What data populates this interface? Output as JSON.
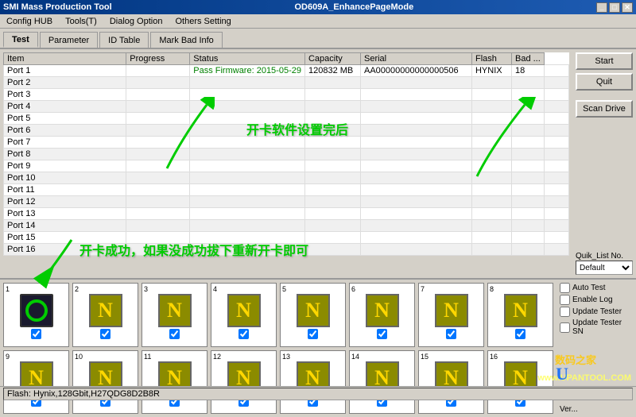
{
  "titleBar": {
    "left": "SMI Mass Production Tool",
    "right": "OD609A_EnhancePageMode",
    "minBtn": "_",
    "maxBtn": "□",
    "closeBtn": "✕"
  },
  "menuBar": {
    "items": [
      "Config HUB",
      "Tools(T)",
      "Dialog Option",
      "Others Setting"
    ]
  },
  "tabs": {
    "items": [
      "Test",
      "Parameter",
      "ID Table",
      "Mark Bad Info"
    ],
    "active": 0
  },
  "table": {
    "headers": [
      "Item",
      "Progress",
      "Status",
      "Capacity",
      "Serial",
      "Flash",
      "Bad ..."
    ],
    "rows": [
      [
        "Port 1",
        "",
        "Pass  Firmware: 2015-05-29",
        "120832 MB",
        "AA00000000000000506",
        "HYNIX",
        "18",
        ""
      ],
      [
        "Port 2",
        "",
        "",
        "",
        "",
        "",
        "",
        ""
      ],
      [
        "Port 3",
        "",
        "",
        "",
        "",
        "",
        "",
        ""
      ],
      [
        "Port 4",
        "",
        "",
        "",
        "",
        "",
        "",
        ""
      ],
      [
        "Port 5",
        "",
        "",
        "",
        "",
        "",
        "",
        ""
      ],
      [
        "Port 6",
        "",
        "",
        "",
        "",
        "",
        "",
        ""
      ],
      [
        "Port 7",
        "",
        "",
        "",
        "",
        "",
        "",
        ""
      ],
      [
        "Port 8",
        "",
        "",
        "",
        "",
        "",
        "",
        ""
      ],
      [
        "Port 9",
        "",
        "",
        "",
        "",
        "",
        "",
        ""
      ],
      [
        "Port 10",
        "",
        "",
        "",
        "",
        "",
        "",
        ""
      ],
      [
        "Port 11",
        "",
        "",
        "",
        "",
        "",
        "",
        ""
      ],
      [
        "Port 12",
        "",
        "",
        "",
        "",
        "",
        "",
        ""
      ],
      [
        "Port 13",
        "",
        "",
        "",
        "",
        "",
        "",
        ""
      ],
      [
        "Port 14",
        "",
        "",
        "",
        "",
        "",
        "",
        ""
      ],
      [
        "Port 15",
        "",
        "",
        "",
        "",
        "",
        "",
        ""
      ],
      [
        "Port 16",
        "",
        "",
        "",
        "",
        "",
        "",
        ""
      ]
    ]
  },
  "sidebar": {
    "startBtn": "Start",
    "quitBtn": "Quit",
    "scanBtn": "Scan Drive",
    "quikLabel": "Quik_List No.",
    "quikDefault": "Default"
  },
  "annotations": {
    "text1": "开卡软件设置完后",
    "text2": "开卡成功，如果没成功拔下重新开卡即可"
  },
  "ports": {
    "items": [
      {
        "num": "1",
        "type": "active",
        "checked": true
      },
      {
        "num": "2",
        "type": "n",
        "checked": true
      },
      {
        "num": "3",
        "type": "n",
        "checked": true
      },
      {
        "num": "4",
        "type": "n",
        "checked": true
      },
      {
        "num": "5",
        "type": "n",
        "checked": true
      },
      {
        "num": "6",
        "type": "n",
        "checked": true
      },
      {
        "num": "7",
        "type": "n",
        "checked": true
      },
      {
        "num": "8",
        "type": "n",
        "checked": true
      },
      {
        "num": "9",
        "type": "n",
        "checked": true
      },
      {
        "num": "10",
        "type": "n",
        "checked": true
      },
      {
        "num": "11",
        "type": "n",
        "checked": true
      },
      {
        "num": "12",
        "type": "n",
        "checked": true
      },
      {
        "num": "13",
        "type": "n",
        "checked": true
      },
      {
        "num": "14",
        "type": "n",
        "checked": true
      },
      {
        "num": "15",
        "type": "n",
        "checked": true
      },
      {
        "num": "16",
        "type": "n",
        "checked": true
      }
    ]
  },
  "rightControls": {
    "quikDefault": "Default",
    "checkboxes": [
      "Auto Test",
      "Enable Log",
      "Update Tester",
      "Update Tester SN"
    ],
    "versionLabel": "Ver..."
  },
  "statusBar": {
    "text": "Flash: Hynix,128Gbit,H27QDG8D2B8R"
  },
  "watermark1": "数码之家",
  "watermark2": "www.UPANTOOL.COM"
}
